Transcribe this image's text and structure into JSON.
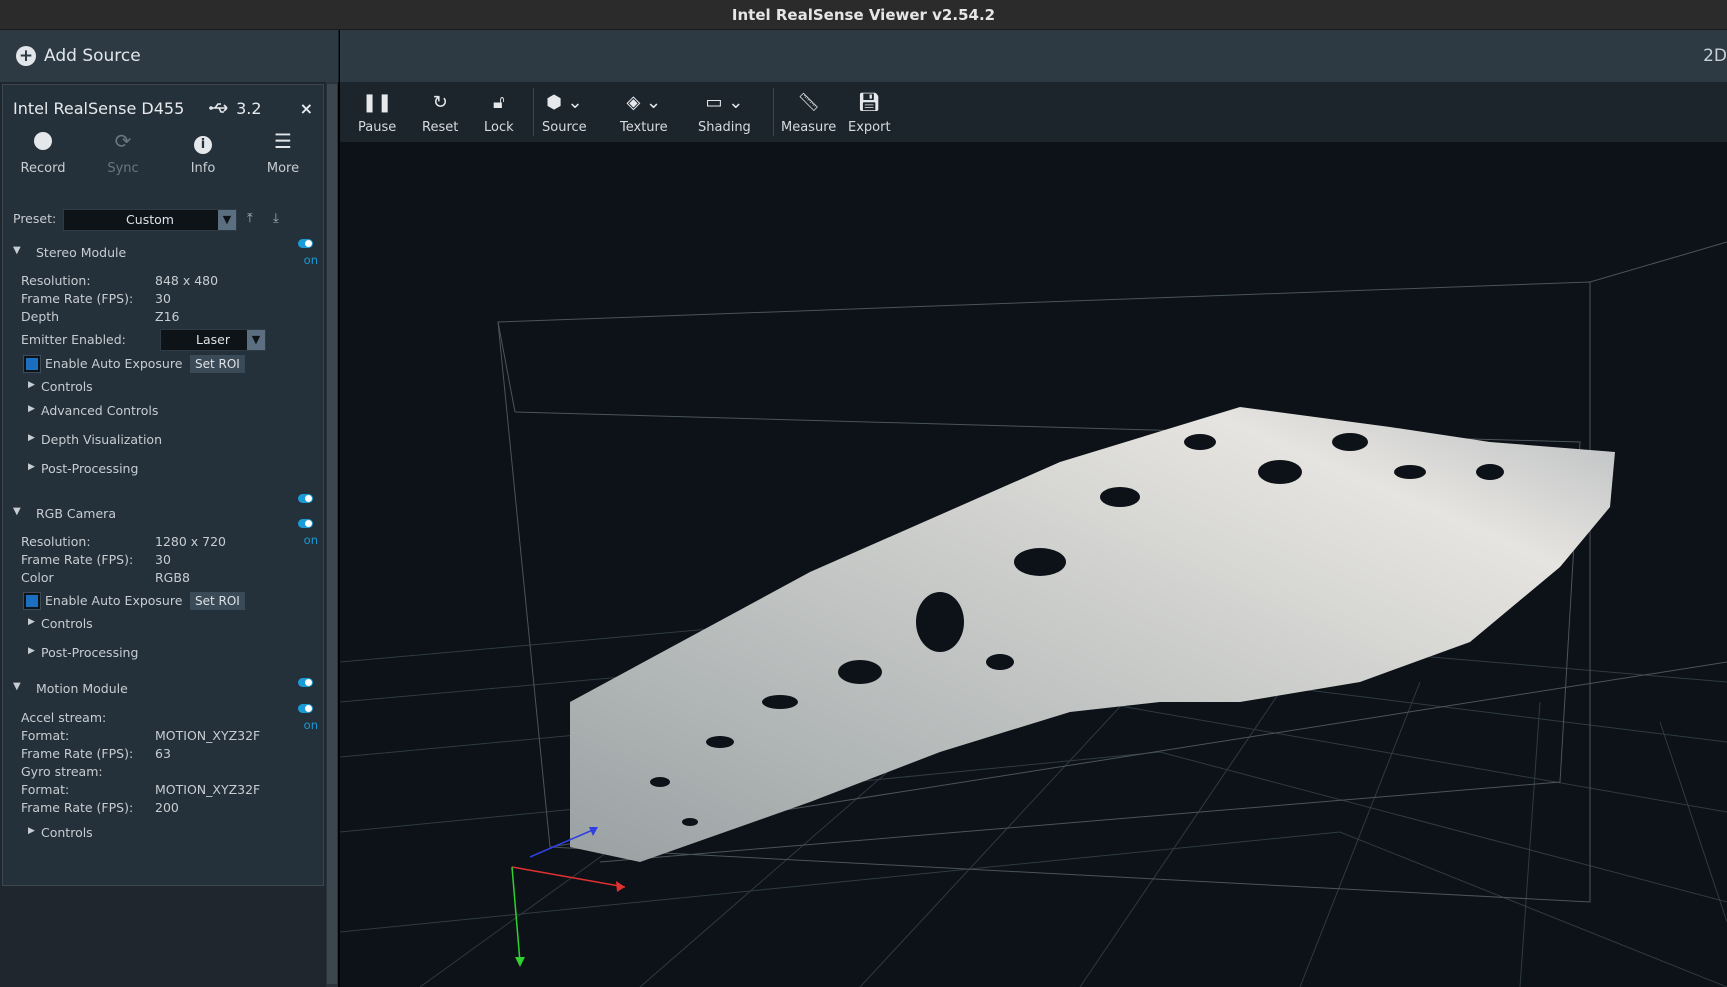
{
  "window": {
    "title": "Intel RealSense Viewer v2.54.2"
  },
  "top_bar": {
    "add_source_label": "Add Source",
    "view_mode_label": "2D"
  },
  "device": {
    "name": "Intel RealSense D455",
    "usb_label": "3.2",
    "close_glyph": "×",
    "actions": [
      {
        "label": "Record",
        "icon": "record-icon",
        "enabled": true
      },
      {
        "label": "Sync",
        "icon": "sync-icon",
        "enabled": false
      },
      {
        "label": "Info",
        "icon": "info-icon",
        "enabled": true
      },
      {
        "label": "More",
        "icon": "menu-icon",
        "enabled": true
      }
    ],
    "preset": {
      "label": "Preset:",
      "value": "Custom"
    }
  },
  "stereo_module": {
    "title": "Stereo Module",
    "toggle_label": "on",
    "resolution_label": "Resolution:",
    "resolution_value": "848 x 480",
    "fps_label": "Frame Rate (FPS):",
    "fps_value": "30",
    "format_label": "Depth",
    "format_value": "Z16",
    "emitter_label": "Emitter Enabled:",
    "emitter_value": "Laser",
    "auto_exposure_label": "Enable Auto Exposure",
    "auto_exposure_checked": true,
    "set_roi_label": "Set ROI",
    "controls_label": "Controls",
    "advanced_label": "Advanced Controls",
    "depth_vis_label": "Depth Visualization",
    "post_processing_label": "Post-Processing"
  },
  "rgb_camera": {
    "title": "RGB Camera",
    "toggle_label": "on",
    "resolution_label": "Resolution:",
    "resolution_value": "1280 x 720",
    "fps_label": "Frame Rate (FPS):",
    "fps_value": "30",
    "format_label": "Color",
    "format_value": "RGB8",
    "auto_exposure_label": "Enable Auto Exposure",
    "auto_exposure_checked": true,
    "set_roi_label": "Set ROI",
    "controls_label": "Controls",
    "post_processing_label": "Post-Processing"
  },
  "motion_module": {
    "title": "Motion Module",
    "toggle_label": "on",
    "accel_label": "Accel stream:",
    "accel_format_label": "Format:",
    "accel_format_value": "MOTION_XYZ32F",
    "accel_fps_label": "Frame Rate (FPS):",
    "accel_fps_value": "63",
    "gyro_label": "Gyro stream:",
    "gyro_format_label": "Format:",
    "gyro_format_value": "MOTION_XYZ32F",
    "gyro_fps_label": "Frame Rate (FPS):",
    "gyro_fps_value": "200",
    "controls_label": "Controls"
  },
  "toolbar": {
    "pause": "Pause",
    "reset": "Reset",
    "lock": "Lock",
    "source": "Source",
    "texture": "Texture",
    "shading": "Shading",
    "measure": "Measure",
    "export": "Export"
  },
  "colors": {
    "accent": "#1a9ad6",
    "panel_bg": "#24303a",
    "viewport_bg": "#0c1217",
    "axis_x": "#e03030",
    "axis_y": "#30d030",
    "axis_z": "#3040e0"
  }
}
